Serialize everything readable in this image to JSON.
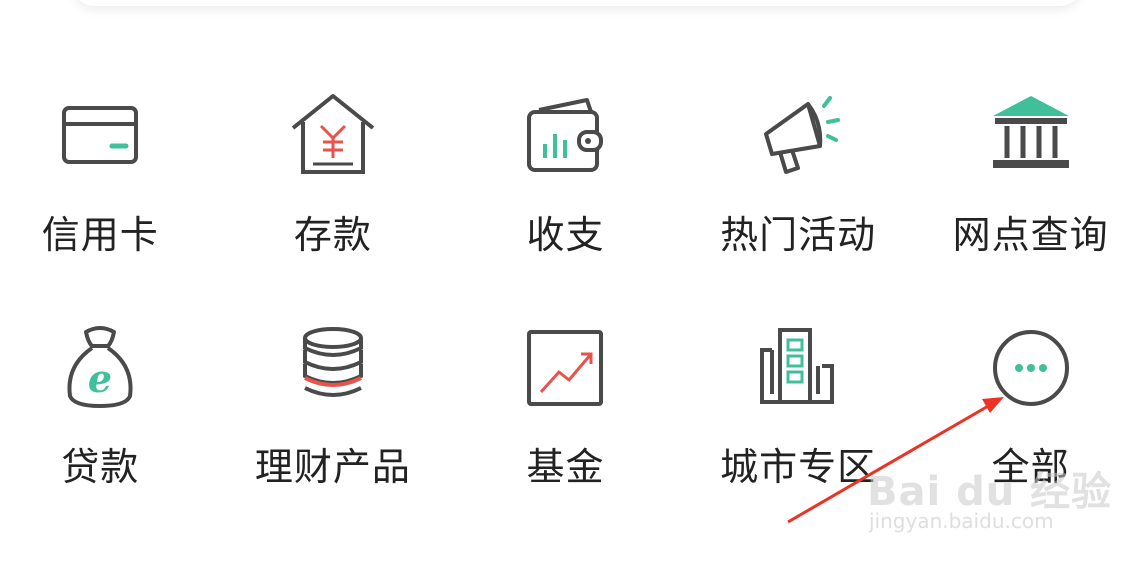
{
  "colors": {
    "stroke": "#4a4a4a",
    "accent_green": "#3fbf9a",
    "accent_red": "#e8534c",
    "arrow": "#ea3323"
  },
  "row1": [
    {
      "label": "信用卡",
      "icon": "credit-card-icon"
    },
    {
      "label": "存款",
      "icon": "house-yuan-icon"
    },
    {
      "label": "收支",
      "icon": "wallet-chart-icon"
    },
    {
      "label": "热门活动",
      "icon": "megaphone-icon"
    },
    {
      "label": "网点查询",
      "icon": "bank-building-icon"
    }
  ],
  "row2": [
    {
      "label": "贷款",
      "icon": "money-bag-icon"
    },
    {
      "label": "理财产品",
      "icon": "coin-stack-icon"
    },
    {
      "label": "基金",
      "icon": "trend-chart-icon"
    },
    {
      "label": "城市专区",
      "icon": "city-building-icon"
    },
    {
      "label": "全部",
      "icon": "more-dots-icon"
    }
  ],
  "watermark": {
    "logo_text": "Bai du 经验",
    "url": "jingyan.baidu.com"
  }
}
